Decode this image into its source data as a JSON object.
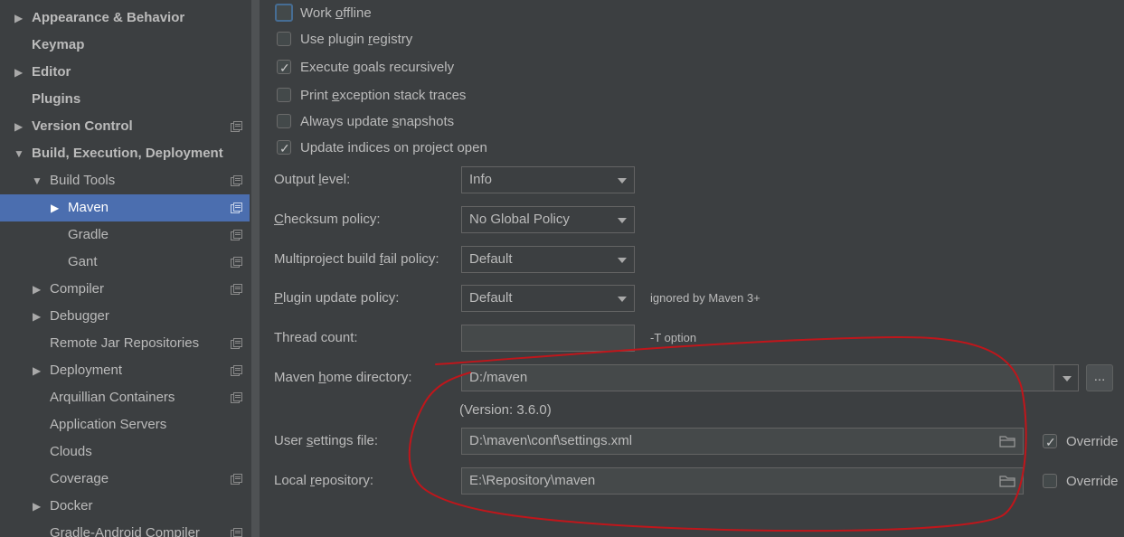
{
  "sidebar": {
    "items": [
      {
        "label": "Appearance & Behavior",
        "expander": "collapsed"
      },
      {
        "label": "Keymap",
        "expander": "none"
      },
      {
        "label": "Editor",
        "expander": "collapsed"
      },
      {
        "label": "Plugins",
        "expander": "none"
      },
      {
        "label": "Version Control",
        "expander": "collapsed"
      },
      {
        "label": "Build, Execution, Deployment",
        "expander": "expanded"
      },
      {
        "label": "Build Tools",
        "expander": "expanded"
      },
      {
        "label": "Maven",
        "expander": "collapsed",
        "selected": true
      },
      {
        "label": "Gradle",
        "expander": "none"
      },
      {
        "label": "Gant",
        "expander": "none"
      },
      {
        "label": "Compiler",
        "expander": "collapsed"
      },
      {
        "label": "Debugger",
        "expander": "collapsed"
      },
      {
        "label": "Remote Jar Repositories",
        "expander": "none"
      },
      {
        "label": "Deployment",
        "expander": "collapsed"
      },
      {
        "label": "Arquillian Containers",
        "expander": "none"
      },
      {
        "label": "Application Servers",
        "expander": "none"
      },
      {
        "label": "Clouds",
        "expander": "none"
      },
      {
        "label": "Coverage",
        "expander": "none"
      },
      {
        "label": "Docker",
        "expander": "collapsed"
      },
      {
        "label": "Gradle-Android Compiler",
        "expander": "none"
      }
    ]
  },
  "checkboxes": [
    {
      "pre": "Work ",
      "mn": "o",
      "post": "ffline",
      "checked": false
    },
    {
      "pre": "Use plugin ",
      "mn": "r",
      "post": "egistry",
      "checked": false
    },
    {
      "pre": "Execute ",
      "mn": "g",
      "post": "oals recursively",
      "checked": true
    },
    {
      "pre": "Print ",
      "mn": "e",
      "post": "xception stack traces",
      "checked": false
    },
    {
      "pre": "Always update ",
      "mn": "s",
      "post": "napshots",
      "checked": false
    },
    {
      "pre": "Update indices on project open",
      "mn": "",
      "post": "",
      "checked": true
    }
  ],
  "form": {
    "output_level": {
      "pre": "Output ",
      "mn": "l",
      "post": "evel:",
      "value": "Info"
    },
    "checksum_policy": {
      "pre": "",
      "mn": "C",
      "post": "hecksum policy:",
      "value": "No Global Policy"
    },
    "multiproject_policy": {
      "pre": "Multiproject build ",
      "mn": "f",
      "post": "ail policy:",
      "value": "Default"
    },
    "plugin_update_policy": {
      "pre": "",
      "mn": "P",
      "post": "lugin update policy:",
      "value": "Default",
      "hint": "ignored by Maven 3+"
    },
    "thread_count": {
      "label": "Thread count:",
      "value": "",
      "hint": "-T option"
    },
    "maven_home": {
      "pre": "Maven ",
      "mn": "h",
      "post": "ome directory:",
      "value": "D:/maven",
      "browse": "...",
      "version": "(Version: 3.6.0)"
    },
    "user_settings": {
      "pre": "User ",
      "mn": "s",
      "post": "ettings file:",
      "value": "D:\\maven\\conf\\settings.xml",
      "override_label": "Override",
      "override_checked": true
    },
    "local_repository": {
      "pre": "Local ",
      "mn": "r",
      "post": "epository:",
      "value": "E:\\Repository\\maven",
      "override_label": "Override",
      "override_checked": false
    }
  },
  "colors": {
    "annotation": "#c0161b",
    "selection": "#4b6eaf",
    "background": "#3c3f41"
  },
  "icons": {
    "expand": "triangle-right-icon",
    "collapse": "triangle-down-icon",
    "project": "project-settings-icon",
    "folder": "folder-icon",
    "check": "checkmark-icon"
  }
}
